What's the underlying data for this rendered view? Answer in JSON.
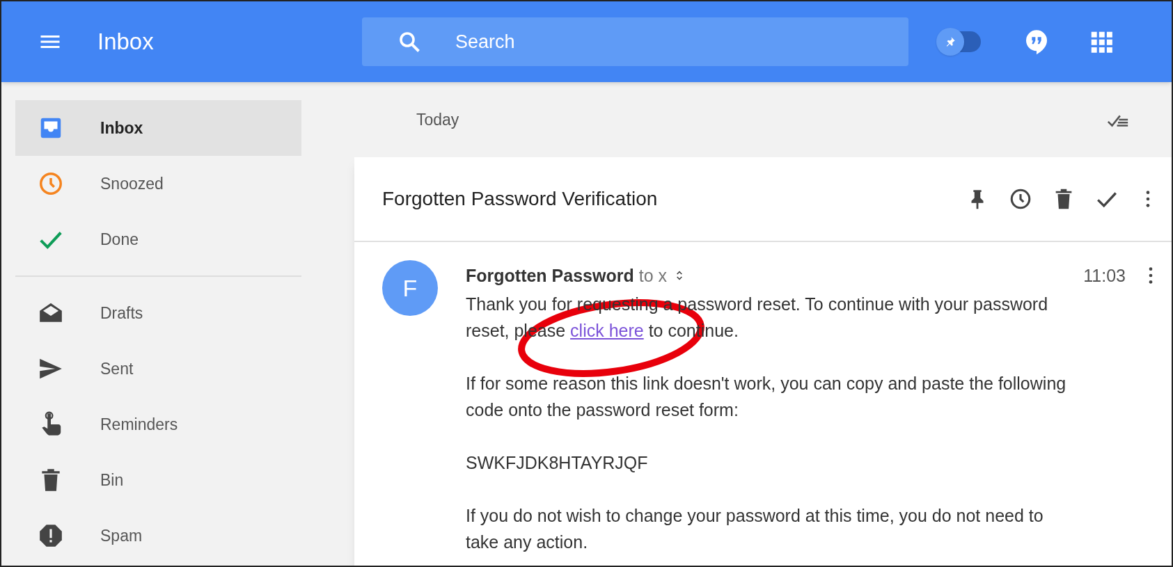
{
  "header": {
    "title": "Inbox",
    "search": {
      "placeholder": "Search"
    },
    "pin_toggle": {
      "on": false
    }
  },
  "sidebar": {
    "groups": [
      [
        {
          "kind": "inbox",
          "label": "Inbox",
          "selected": true
        },
        {
          "kind": "snoozed",
          "label": "Snoozed",
          "selected": false
        },
        {
          "kind": "done",
          "label": "Done",
          "selected": false
        }
      ],
      [
        {
          "kind": "drafts",
          "label": "Drafts",
          "selected": false
        },
        {
          "kind": "sent",
          "label": "Sent",
          "selected": false
        },
        {
          "kind": "reminders",
          "label": "Reminders",
          "selected": false
        },
        {
          "kind": "bin",
          "label": "Bin",
          "selected": false
        },
        {
          "kind": "spam",
          "label": "Spam",
          "selected": false
        }
      ]
    ]
  },
  "section": {
    "label": "Today"
  },
  "message": {
    "subject": "Forgotten Password Verification",
    "avatar_letter": "F",
    "sender": "Forgotten Password",
    "recipient": "to x",
    "time": "11:03",
    "paragraphs": [
      {
        "before": "Thank you for requesting a password reset. To continue with your password reset, please",
        "link": "click here",
        "after": "to continue."
      },
      {
        "before": "If for some reason this link doesn't work, you can copy and paste the following code onto the password reset form:"
      },
      {
        "before": "SWKFJDK8HTAYRJQF"
      },
      {
        "before": "If you do not wish to change your password at this time, you do not need to take any action."
      }
    ]
  },
  "annotation": {
    "kind": "ellipse",
    "color": "#e8000b"
  }
}
